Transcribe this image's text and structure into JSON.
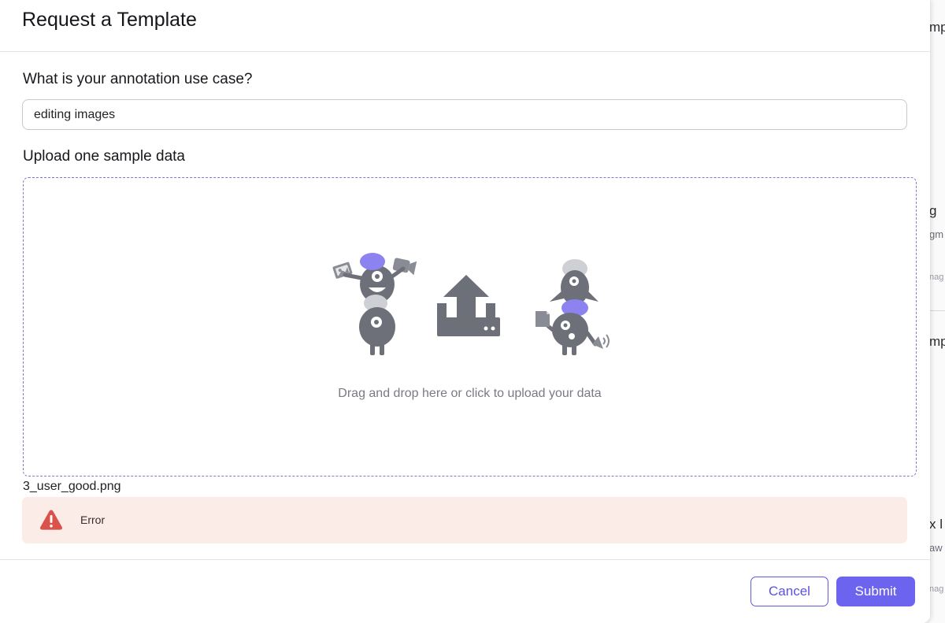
{
  "modal": {
    "title": "Request a Template"
  },
  "form": {
    "use_case_label": "What is your annotation use case?",
    "use_case_value": "editing images",
    "upload_label": "Upload one sample data",
    "dropzone_hint": "Drag and drop here or click to upload your data",
    "file_name": "3_user_good.png",
    "error_text": "Error"
  },
  "footer": {
    "cancel_label": "Cancel",
    "submit_label": "Submit"
  },
  "background": {
    "fragments": [
      "mp",
      "g",
      "gm",
      "nag",
      "mp",
      "x l",
      "aw",
      "nag"
    ]
  },
  "colors": {
    "accent": "#6c63ef",
    "accent_border": "#6159e4",
    "error_bg": "#fbece8",
    "error_icon": "#d9534a",
    "illustration_gray": "#6e7079",
    "illustration_purple": "#8c82f0",
    "illustration_light": "#cfd0d6"
  },
  "icons": {
    "upload_illustration": "upload-illustration",
    "error": "warning-triangle-icon"
  }
}
